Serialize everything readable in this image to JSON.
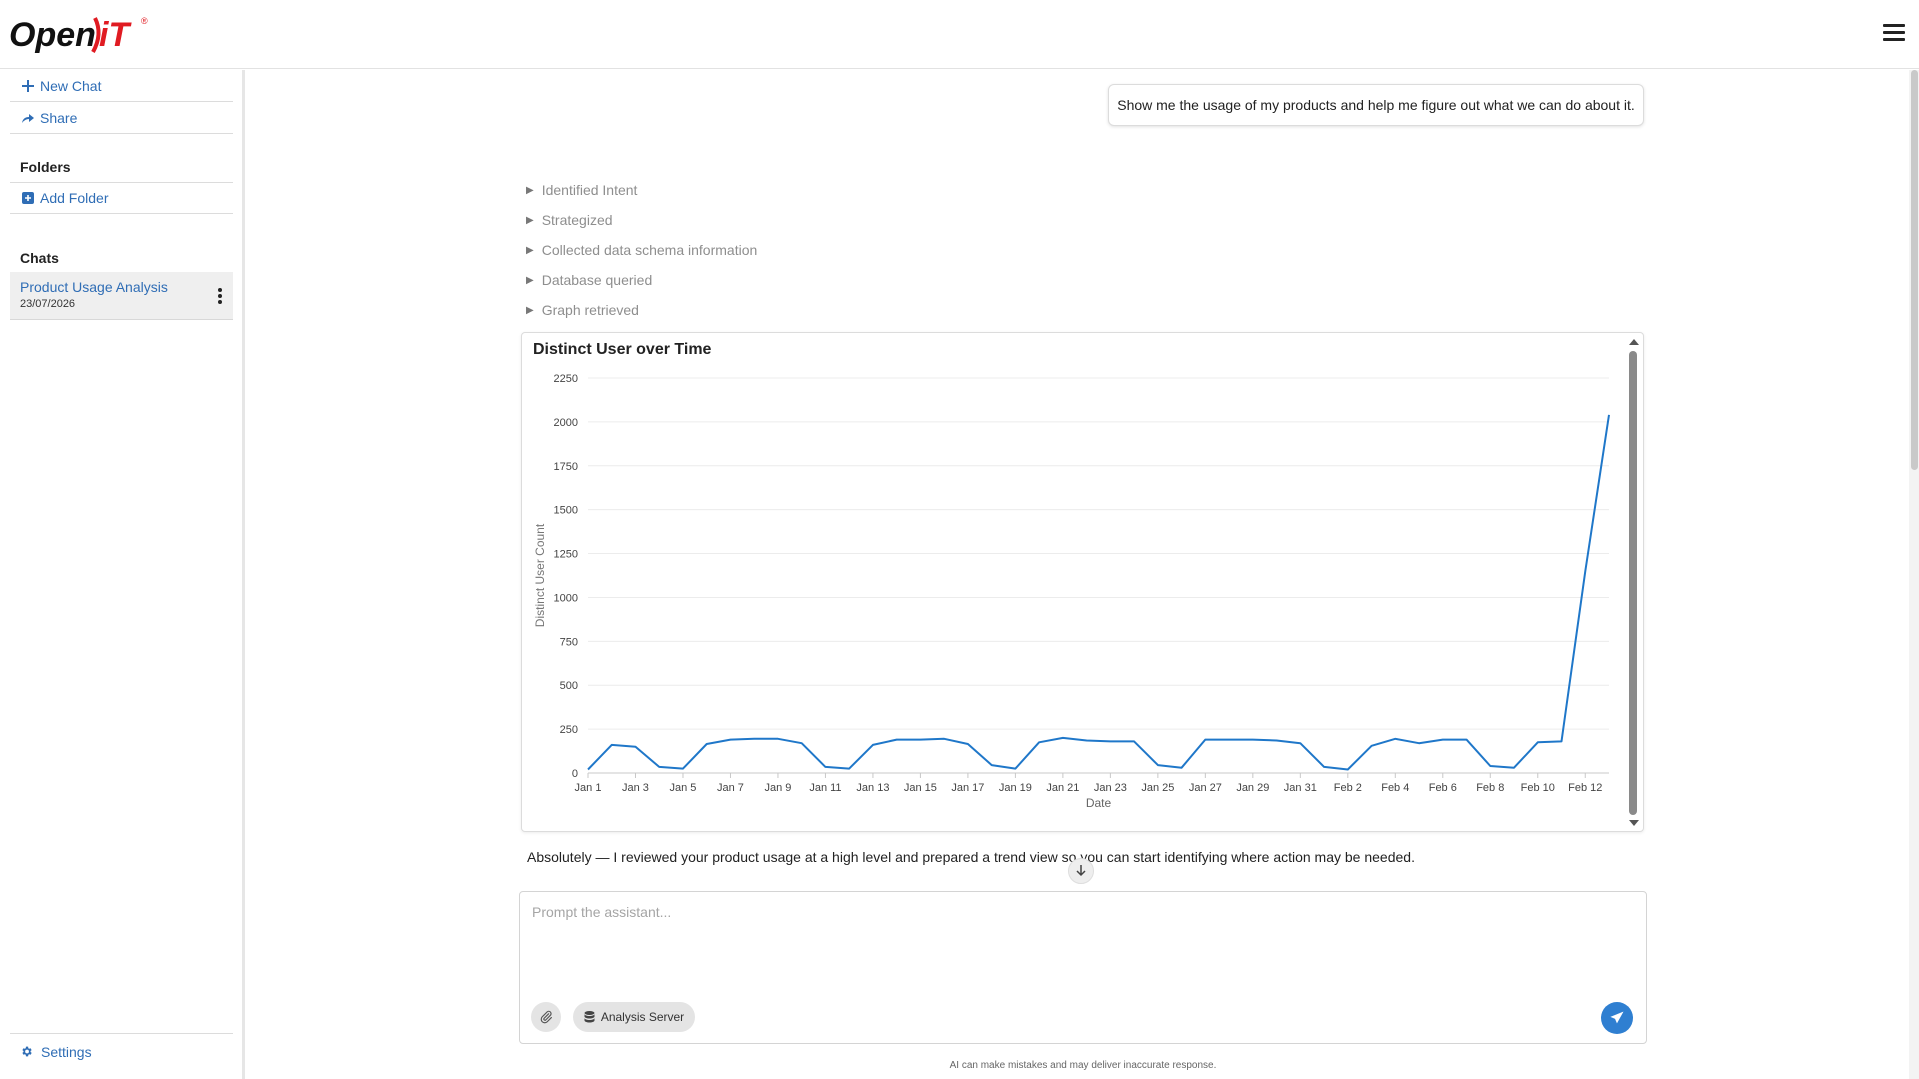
{
  "header": {
    "logo_text_primary": "Open",
    "logo_text_secondary": "iT",
    "logo_registered": "®"
  },
  "sidebar": {
    "new_chat_label": "New Chat",
    "share_label": "Share",
    "folders_heading": "Folders",
    "add_folder_label": "Add Folder",
    "chats_heading": "Chats",
    "chats": [
      {
        "title": "Product Usage Analysis",
        "date": "23/07/2026"
      }
    ],
    "settings_label": "Settings"
  },
  "conversation": {
    "user_message": "Show me the usage of my products and help me figure out what we can do about it.",
    "steps": [
      {
        "label": "Identified Intent"
      },
      {
        "label": "Strategized"
      },
      {
        "label": "Collected data schema information"
      },
      {
        "label": "Database queried"
      },
      {
        "label": "Graph retrieved"
      }
    ],
    "assistant_message": "Absolutely — I reviewed your product usage at a high level and prepared a trend view so you can start identifying where action may be needed."
  },
  "chart_data": {
    "type": "line",
    "title": "Distinct User over Time",
    "xlabel": "Date",
    "ylabel": "Distinct User Count",
    "ylim": [
      0,
      2250
    ],
    "yticks": [
      0,
      250,
      500,
      750,
      1000,
      1250,
      1500,
      1750,
      2000,
      2250
    ],
    "x": [
      "Jan 1",
      "Jan 2",
      "Jan 3",
      "Jan 4",
      "Jan 5",
      "Jan 6",
      "Jan 7",
      "Jan 8",
      "Jan 9",
      "Jan 10",
      "Jan 11",
      "Jan 12",
      "Jan 13",
      "Jan 14",
      "Jan 15",
      "Jan 16",
      "Jan 17",
      "Jan 18",
      "Jan 19",
      "Jan 20",
      "Jan 21",
      "Jan 22",
      "Jan 23",
      "Jan 24",
      "Jan 25",
      "Jan 26",
      "Jan 27",
      "Jan 28",
      "Jan 29",
      "Jan 30",
      "Jan 31",
      "Feb 1",
      "Feb 2",
      "Feb 3",
      "Feb 4",
      "Feb 5",
      "Feb 6",
      "Feb 7",
      "Feb 8",
      "Feb 9",
      "Feb 10",
      "Feb 11",
      "Feb 12",
      "Feb 13"
    ],
    "xtick_labels": [
      "Jan 1",
      "Jan 3",
      "Jan 5",
      "Jan 7",
      "Jan 9",
      "Jan 11",
      "Jan 13",
      "Jan 15",
      "Jan 17",
      "Jan 19",
      "Jan 21",
      "Jan 23",
      "Jan 25",
      "Jan 27",
      "Jan 29",
      "Jan 31",
      "Feb 2",
      "Feb 4",
      "Feb 6",
      "Feb 8",
      "Feb 10",
      "Feb 12"
    ],
    "series": [
      {
        "values": [
          20,
          160,
          150,
          35,
          25,
          165,
          190,
          195,
          195,
          170,
          35,
          25,
          160,
          190,
          190,
          195,
          165,
          45,
          25,
          175,
          200,
          185,
          180,
          180,
          45,
          30,
          190,
          190,
          190,
          185,
          170,
          35,
          20,
          155,
          195,
          170,
          190,
          190,
          40,
          30,
          175,
          180,
          1150,
          2040
        ],
        "color": "#1f77c9"
      }
    ],
    "grid": true
  },
  "prompt": {
    "placeholder": "Prompt the assistant...",
    "value": "",
    "server_label": "Analysis Server",
    "disclaimer": "AI can make mistakes and may deliver inaccurate response."
  },
  "colors": {
    "accent": "#2f6db5",
    "send_button": "#2f7fd1",
    "line": "#1f77c9",
    "logo_red": "#e01b22"
  },
  "icons": {
    "menu": "hamburger-icon",
    "new_chat": "plus-icon",
    "share": "share-icon",
    "add_folder": "plus-square-icon",
    "chat_options": "kebab-icon",
    "settings": "gear-icon",
    "attach": "paperclip-icon",
    "server": "database-icon",
    "send": "paper-plane-icon",
    "scroll_down": "arrow-down-icon"
  }
}
